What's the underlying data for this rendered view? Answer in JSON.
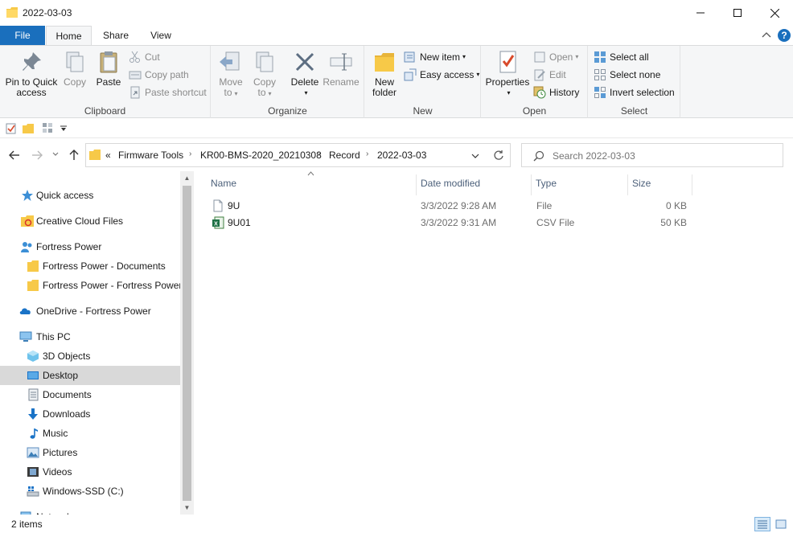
{
  "window": {
    "title": "2022-03-03",
    "minimize": "minimize",
    "maximize": "maximize",
    "close": "close"
  },
  "ribbon_tabs": {
    "file": "File",
    "home": "Home",
    "share": "Share",
    "view": "View"
  },
  "ribbon": {
    "clipboard": {
      "label": "Clipboard",
      "pin_line1": "Pin to Quick",
      "pin_line2": "access",
      "copy": "Copy",
      "paste": "Paste",
      "cut": "Cut",
      "copy_path": "Copy path",
      "paste_shortcut": "Paste shortcut"
    },
    "organize": {
      "label": "Organize",
      "move_line1": "Move",
      "move_line2": "to",
      "copy_line1": "Copy",
      "copy_line2": "to",
      "delete": "Delete",
      "rename": "Rename"
    },
    "new": {
      "label": "New",
      "new_folder_line1": "New",
      "new_folder_line2": "folder",
      "new_item": "New item",
      "easy_access": "Easy access"
    },
    "open": {
      "label": "Open",
      "properties": "Properties",
      "open": "Open",
      "edit": "Edit",
      "history": "History"
    },
    "select": {
      "label": "Select",
      "select_all": "Select all",
      "select_none": "Select none",
      "invert_selection": "Invert selection"
    }
  },
  "address": {
    "overflow": "«",
    "crumbs": [
      "Firmware Tools",
      "KR00-BMS-2020_20210308",
      "Record",
      "2022-03-03"
    ],
    "search_placeholder": "Search 2022-03-03"
  },
  "nav": {
    "items": [
      {
        "label": "Quick access",
        "icon": "star-icon"
      },
      {
        "label": "Creative Cloud Files",
        "icon": "creative-cloud-icon"
      },
      {
        "label": "Fortress Power",
        "icon": "people-icon"
      },
      {
        "label": "Fortress Power - Documents",
        "icon": "folder-icon"
      },
      {
        "label": "Fortress Power - Fortress Power (",
        "icon": "folder-icon"
      },
      {
        "label": "OneDrive - Fortress Power",
        "icon": "cloud-icon"
      },
      {
        "label": "This PC",
        "icon": "computer-icon"
      },
      {
        "label": "3D Objects",
        "icon": "cube-icon"
      },
      {
        "label": "Desktop",
        "icon": "desktop-icon"
      },
      {
        "label": "Documents",
        "icon": "documents-icon"
      },
      {
        "label": "Downloads",
        "icon": "downloads-icon"
      },
      {
        "label": "Music",
        "icon": "music-icon"
      },
      {
        "label": "Pictures",
        "icon": "pictures-icon"
      },
      {
        "label": "Videos",
        "icon": "videos-icon"
      },
      {
        "label": "Windows-SSD (C:)",
        "icon": "drive-icon"
      },
      {
        "label": "Network",
        "icon": "network-icon"
      }
    ],
    "selected": "Desktop"
  },
  "table": {
    "columns": [
      "Name",
      "Date modified",
      "Type",
      "Size"
    ],
    "rows": [
      {
        "name": "9U",
        "date": "3/3/2022 9:28 AM",
        "type": "File",
        "size": "0 KB",
        "icon": "file-icon"
      },
      {
        "name": "9U01",
        "date": "3/3/2022 9:31 AM",
        "type": "CSV File",
        "size": "50 KB",
        "icon": "csv-file-icon"
      }
    ]
  },
  "status": {
    "items": "2 items"
  },
  "colors": {
    "accent": "#1a6fbd",
    "selection": "#d9d9d9",
    "folder": "#f7c948"
  }
}
